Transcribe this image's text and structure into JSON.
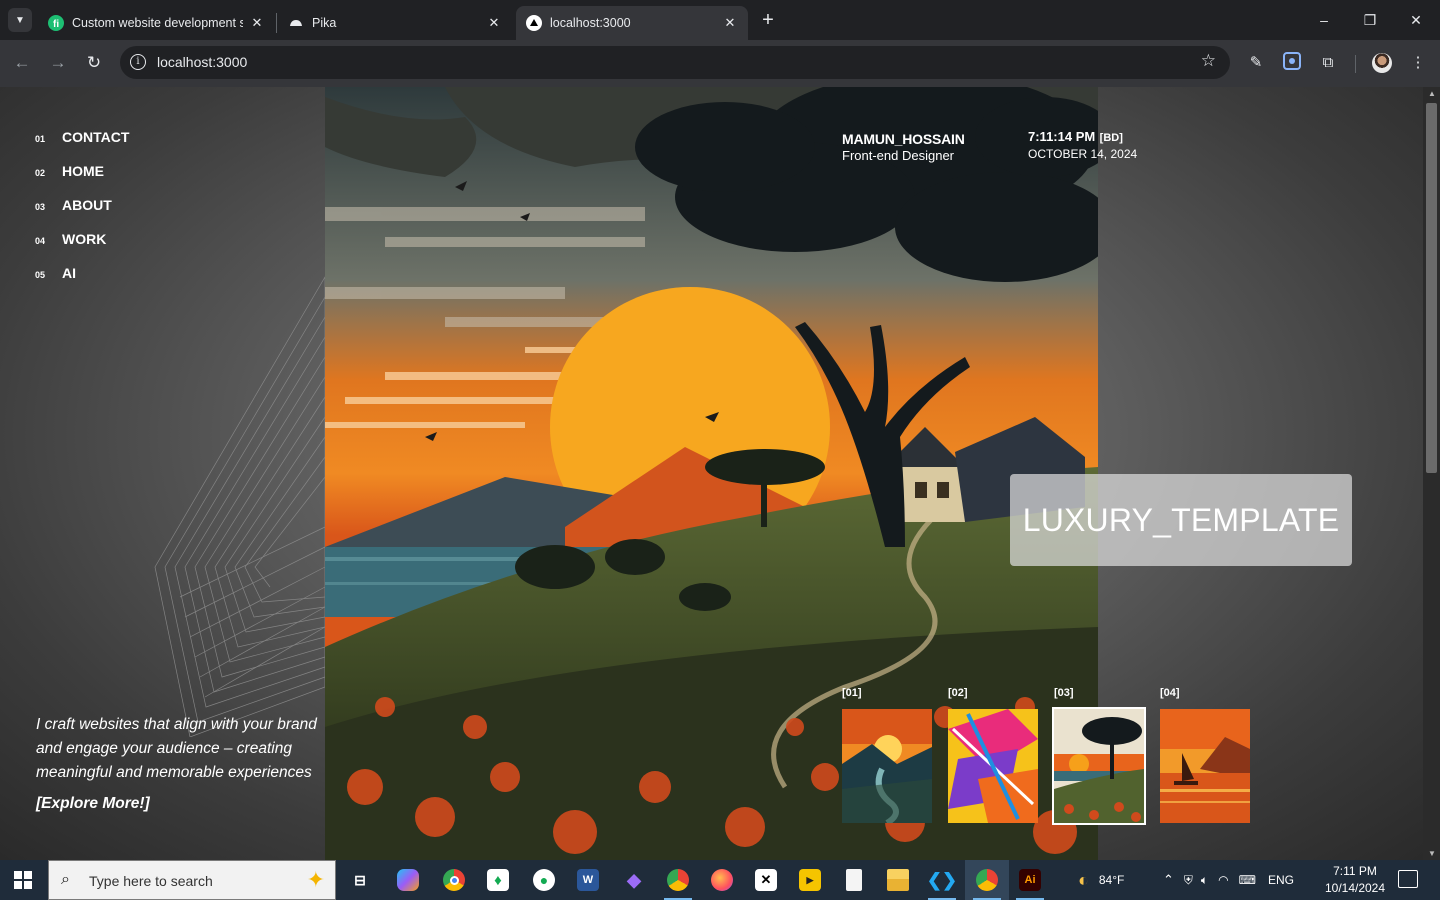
{
  "browser": {
    "tabs": [
      {
        "title": "Custom website development s",
        "favicon": "fiverr-icon",
        "active": false
      },
      {
        "title": "Pika",
        "favicon": "pika-icon",
        "active": false
      },
      {
        "title": "localhost:3000",
        "favicon": "vercel-icon",
        "active": true
      }
    ],
    "url": "localhost:3000",
    "window_controls": {
      "minimize": "–",
      "maximize": "❐",
      "close": "✕"
    }
  },
  "page": {
    "nav": [
      {
        "num": "01",
        "label": "CONTACT"
      },
      {
        "num": "02",
        "label": "HOME"
      },
      {
        "num": "03",
        "label": "ABOUT"
      },
      {
        "num": "04",
        "label": "WORK"
      },
      {
        "num": "05",
        "label": "AI"
      }
    ],
    "identity": {
      "name": "MAMUN_HOSSAIN",
      "role": "Front-end Designer"
    },
    "clock": {
      "time": "7:11:14 PM",
      "tz": "[BD]",
      "date": "OCTOBER 14, 2024"
    },
    "badge": "LUXURY_TEMPLATE",
    "thumbnails": [
      {
        "index": "[01]",
        "theme": "sunset-river",
        "selected": false
      },
      {
        "index": "[02]",
        "theme": "abstract-paint",
        "selected": false
      },
      {
        "index": "[03]",
        "theme": "tree-landscape",
        "selected": true
      },
      {
        "index": "[04]",
        "theme": "sailboat-sunset",
        "selected": false
      }
    ],
    "tagline": "I craft websites that align with your brand and engage your audience – creating meaningful and memorable experiences",
    "cta": "[Explore More!]"
  },
  "taskbar": {
    "search_placeholder": "Type here to search",
    "weather": "84°F",
    "language": "ENG",
    "time": "7:11 PM",
    "date": "10/14/2024",
    "apps": [
      "task-view",
      "copilot",
      "chrome",
      "mongodb-compass",
      "whatsapp",
      "word",
      "obsidian",
      "chrome-profile",
      "firefox",
      "capcut",
      "potplayer",
      "notepad",
      "file-explorer",
      "vscode",
      "chrome-active",
      "illustrator"
    ]
  },
  "colors": {
    "accent_blue": "#76b9ed",
    "sunset_orange": "#e8641c",
    "sun_gold": "#f6a01a"
  }
}
